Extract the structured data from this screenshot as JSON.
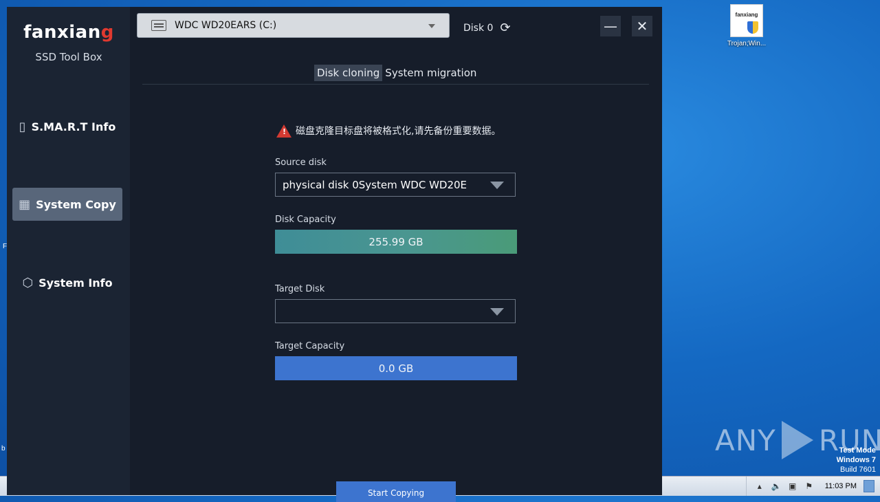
{
  "desktop": {
    "icon_label": "Trojan;Win...",
    "icon_brand": "fanxiang",
    "watermark": {
      "any": "ANY",
      "run": "RUN"
    },
    "test_mode": {
      "line1": "Test Mode",
      "line2": "Windows 7",
      "line3": "Build 7601"
    },
    "left_edge_chars": {
      "top": "F",
      "bottom": "b"
    }
  },
  "taskbar": {
    "clock": "11:03 PM"
  },
  "app": {
    "logo": {
      "brand_pre": "fanxian",
      "brand_post": "g",
      "subtitle": "SSD Tool Box"
    },
    "sidebar": {
      "items": [
        {
          "label": "S.MA.R.T Info",
          "active": false
        },
        {
          "label": "System Copy",
          "active": true
        },
        {
          "label": "System Info",
          "active": false
        }
      ]
    },
    "header": {
      "disk_select_value": "WDC WD20EARS  (C:)",
      "disk_number": "Disk 0"
    },
    "tabs": [
      {
        "label": "Disk cloning",
        "active": true
      },
      {
        "label": "System migration",
        "active": false
      }
    ],
    "warning_text": "磁盘克隆目标盘将被格式化,请先备份重要数据。",
    "source_disk": {
      "label": "Source disk",
      "value": "physical disk 0System  WDC WD20E"
    },
    "disk_capacity": {
      "label": "Disk Capacity",
      "value": "255.99 GB"
    },
    "target_disk": {
      "label": "Target Disk",
      "value": ""
    },
    "target_capacity": {
      "label": "Target Capacity",
      "value": "0.0 GB"
    },
    "start_button": "Start Copying",
    "colors": {
      "window_bg": "#161d2a",
      "sidebar_bg": "#1b2433",
      "active_nav": "#58667a",
      "accent_blue": "#3d74cf",
      "accent_teal": "#4a9690",
      "warning_red": "#d23a32"
    }
  }
}
